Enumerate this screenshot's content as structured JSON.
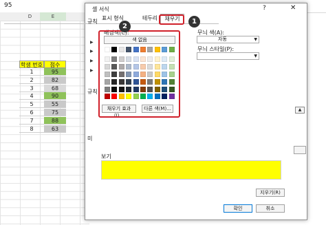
{
  "formula": {
    "value": "95"
  },
  "sheet": {
    "columns": [
      "D",
      "E"
    ],
    "headers": [
      "학생 번호",
      "점수"
    ],
    "rows": [
      {
        "num": "1",
        "score": "95",
        "shade": "#8fc25a"
      },
      {
        "num": "2",
        "score": "82",
        "shade": "#c9c9c9"
      },
      {
        "num": "3",
        "score": "68",
        "shade": "#d9d9d9"
      },
      {
        "num": "4",
        "score": "90",
        "shade": "#8fc25a"
      },
      {
        "num": "5",
        "score": "55",
        "shade": "#c9c9c9"
      },
      {
        "num": "6",
        "score": "75",
        "shade": "#c9c9c9"
      },
      {
        "num": "7",
        "score": "88",
        "shade": "#8fc25a"
      },
      {
        "num": "8",
        "score": "63",
        "shade": "#c9c9c9"
      }
    ]
  },
  "dialog": {
    "title": "셀 서식",
    "help": "?",
    "close": "✕",
    "tabs": [
      "표시 형식",
      "테두리",
      "채우기"
    ],
    "left_cut_labels": [
      "규칙",
      "규칙"
    ],
    "background_label": "배경색(C):",
    "no_color_label": "색 없음",
    "fill_effects_label": "채우기 효과(I)...",
    "more_colors_label": "다른 색(M)...",
    "pattern_color_label": "무늬 색(A):",
    "pattern_color_value": "자동",
    "pattern_style_label": "무늬 스타일(P):",
    "preview_label": "보기",
    "clear_label": "지우기(R)",
    "ok_label": "확인",
    "cancel_label": "취소",
    "badges": [
      "1",
      "2"
    ],
    "side_label_left": "미",
    "side_up_icon": "▲"
  },
  "colors": {
    "accent_highlight": "#d0202a",
    "preview_fill": "#ffff00",
    "theme_row": [
      "#ffffff",
      "#000000",
      "#e7e6e6",
      "#44546a",
      "#4472c4",
      "#ed7d31",
      "#a5a5a5",
      "#ffc000",
      "#5b9bd5",
      "#70ad47"
    ],
    "tints": [
      [
        "#f2f2f2",
        "#7f7f7f",
        "#d0cece",
        "#d6dce4",
        "#d9e2f3",
        "#fbe5d5",
        "#ededed",
        "#fff2cc",
        "#deebf6",
        "#e2efd9"
      ],
      [
        "#d8d8d8",
        "#595959",
        "#aeabab",
        "#adb9ca",
        "#b4c6e7",
        "#f7cbac",
        "#dbdbdb",
        "#fee599",
        "#bdd7ee",
        "#c5e0b3"
      ],
      [
        "#bfbfbf",
        "#3f3f3f",
        "#757070",
        "#8496b0",
        "#8eaadb",
        "#f4b183",
        "#c9c9c9",
        "#ffd966",
        "#9dc3e6",
        "#a8d08d"
      ],
      [
        "#a5a5a5",
        "#262626",
        "#3a3838",
        "#323f4f",
        "#2f5496",
        "#c55a11",
        "#7b7b7b",
        "#bf9000",
        "#2e75b5",
        "#538135"
      ],
      [
        "#7f7f7f",
        "#0c0c0c",
        "#171616",
        "#222a35",
        "#1f3864",
        "#833c0b",
        "#525252",
        "#7f6000",
        "#1e4e79",
        "#375623"
      ]
    ],
    "standard": [
      "#c00000",
      "#ff0000",
      "#ffc000",
      "#ffff00",
      "#92d050",
      "#00b050",
      "#00b0f0",
      "#0070c0",
      "#002060",
      "#7030a0"
    ]
  }
}
